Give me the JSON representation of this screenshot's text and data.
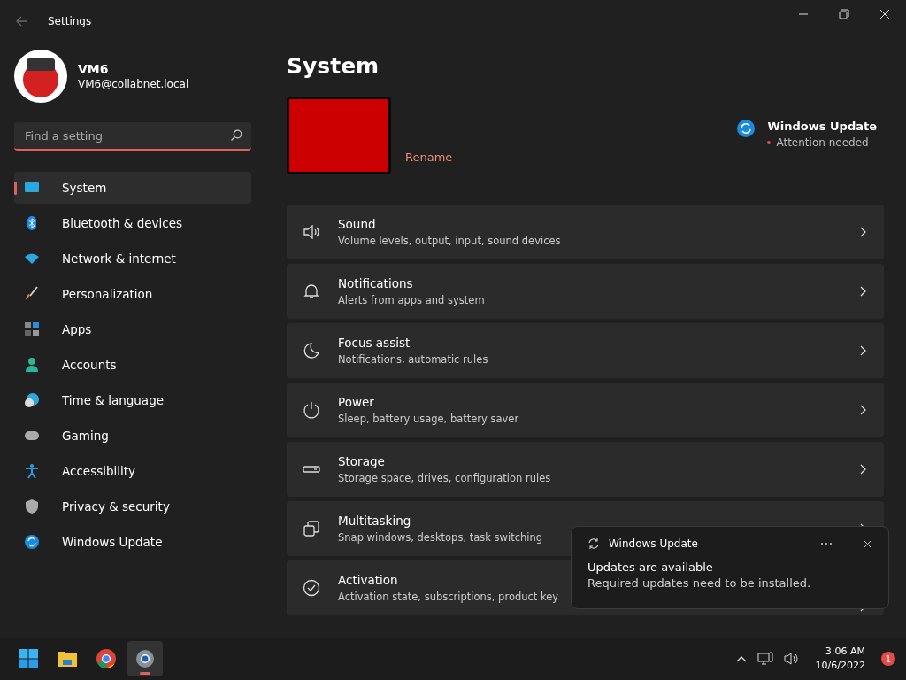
{
  "window": {
    "title": "Settings"
  },
  "account": {
    "name": "VM6",
    "email": "VM6@collabnet.local"
  },
  "search": {
    "placeholder": "Find a setting"
  },
  "sidebar": {
    "items": [
      {
        "label": "System",
        "selected": true
      },
      {
        "label": "Bluetooth & devices",
        "selected": false
      },
      {
        "label": "Network & internet",
        "selected": false
      },
      {
        "label": "Personalization",
        "selected": false
      },
      {
        "label": "Apps",
        "selected": false
      },
      {
        "label": "Accounts",
        "selected": false
      },
      {
        "label": "Time & language",
        "selected": false
      },
      {
        "label": "Gaming",
        "selected": false
      },
      {
        "label": "Accessibility",
        "selected": false
      },
      {
        "label": "Privacy & security",
        "selected": false
      },
      {
        "label": "Windows Update",
        "selected": false
      }
    ]
  },
  "page": {
    "title": "System",
    "rename": "Rename",
    "update": {
      "title": "Windows Update",
      "status": "Attention needed"
    }
  },
  "settings": [
    {
      "title": "Sound",
      "description": "Volume levels, output, input, sound devices"
    },
    {
      "title": "Notifications",
      "description": "Alerts from apps and system"
    },
    {
      "title": "Focus assist",
      "description": "Notifications, automatic rules"
    },
    {
      "title": "Power",
      "description": "Sleep, battery usage, battery saver"
    },
    {
      "title": "Storage",
      "description": "Storage space, drives, configuration rules"
    },
    {
      "title": "Multitasking",
      "description": "Snap windows, desktops, task switching"
    },
    {
      "title": "Activation",
      "description": "Activation state, subscriptions, product key"
    }
  ],
  "notification": {
    "app": "Windows Update",
    "title": "Updates are available",
    "body": "Required updates need to be installed."
  },
  "taskbar": {
    "apps": [
      {
        "selected": false
      },
      {
        "selected": false
      },
      {
        "selected": false
      },
      {
        "selected": true
      }
    ],
    "time": "3:06 AM",
    "date": "10/6/2022",
    "badge": "1"
  }
}
